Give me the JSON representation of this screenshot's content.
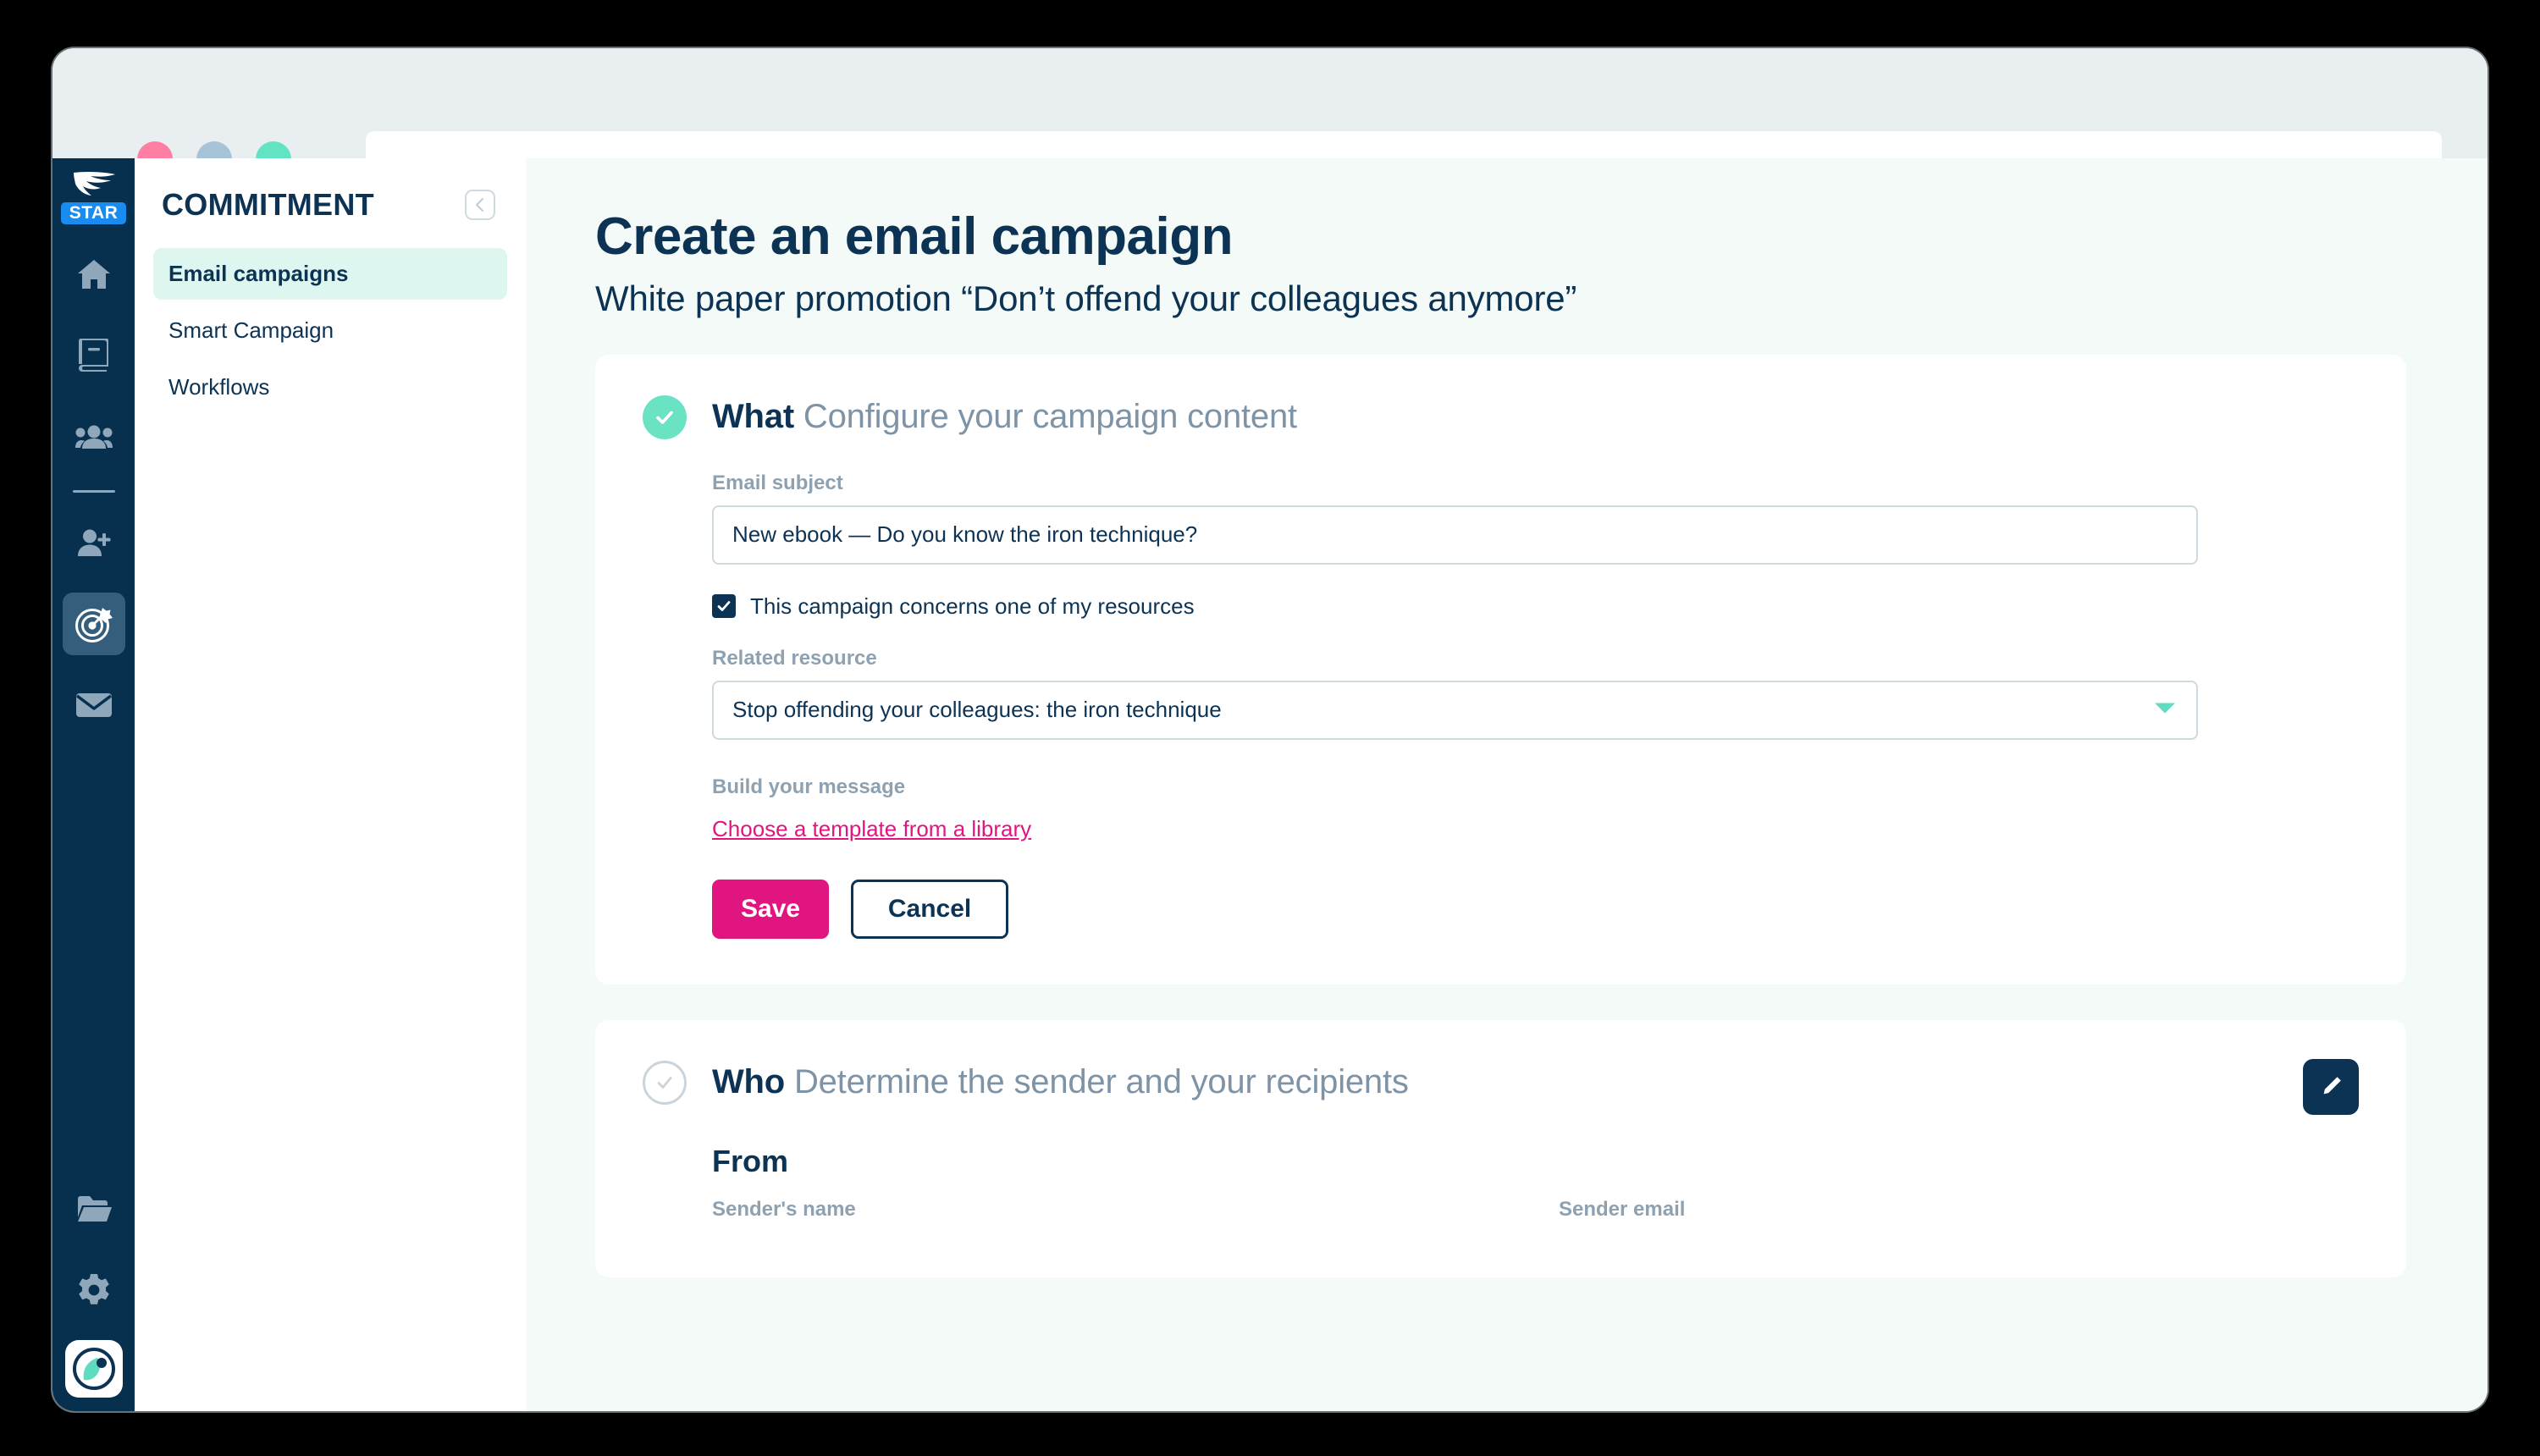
{
  "browser": {
    "traffic_lights": [
      "close",
      "minimize",
      "maximize"
    ],
    "url_value": "",
    "url_placeholder": ""
  },
  "rail": {
    "brand_name": "logo-icon",
    "star_badge": "STAR",
    "items": [
      {
        "name": "home-icon",
        "active": false
      },
      {
        "name": "book-icon",
        "active": false
      },
      {
        "name": "people-icon",
        "active": false
      },
      {
        "name": "add-user-icon",
        "active": false
      },
      {
        "name": "target-icon",
        "active": true
      },
      {
        "name": "mail-icon",
        "active": false
      }
    ],
    "bottom_items": [
      {
        "name": "folder-icon"
      },
      {
        "name": "gear-icon"
      },
      {
        "name": "avatar-icon"
      }
    ]
  },
  "secondary_nav": {
    "title": "COMMITMENT",
    "collapse_icon": "chevron-left-icon",
    "items": [
      {
        "label": "Email campaigns",
        "active": true
      },
      {
        "label": "Smart Campaign",
        "active": false
      },
      {
        "label": "Workflows",
        "active": false
      }
    ]
  },
  "main": {
    "title": "Create an email campaign",
    "subtitle": "White paper promotion “Don’t offend your colleagues anymore”",
    "what_card": {
      "step_label": "What",
      "step_description": "Configure your campaign content",
      "step_state": "done",
      "email_subject_label": "Email subject",
      "email_subject_value": "New ebook — Do you know the iron technique?",
      "email_subject_placeholder": "Email subject",
      "checkbox_label": "This campaign concerns one of my resources",
      "checkbox_checked": true,
      "related_resource_label": "Related resource",
      "related_resource_value": "Stop offending your colleagues: the iron technique",
      "build_message_label": "Build your message",
      "template_link_label": "Choose a template from a library",
      "save_label": "Save",
      "cancel_label": "Cancel"
    },
    "who_card": {
      "step_label": "Who",
      "step_description": "Determine the sender and your recipients",
      "step_state": "todo",
      "edit_icon": "pencil-icon",
      "from_title": "From",
      "sender_name_label": "Sender's name",
      "sender_email_label": "Sender email"
    }
  },
  "colors": {
    "desktop_bg": "#000000",
    "chrome_bg": "#e9eef1",
    "rail_bg": "#07304f",
    "rail_active": "#355d7c",
    "nav_active_bg": "#ddf6f0",
    "content_bg": "#f3faf8",
    "card_bg": "#ffffff",
    "navy": "#0d3354",
    "muted": "#8ea1b1",
    "accent_pink": "#e0157f",
    "accent_mint": "#6ae3c4",
    "star_blue": "#1a8cf0"
  }
}
